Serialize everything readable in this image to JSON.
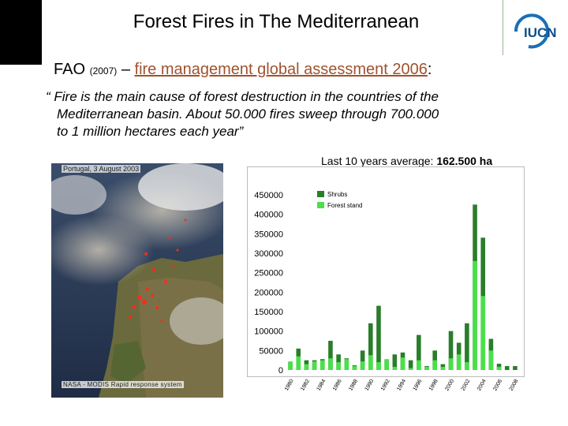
{
  "slide": {
    "title": "Forest Fires in The Mediterranean",
    "fao_source": "FAO",
    "fao_year": "(2007)",
    "fao_dash": "–",
    "fao_link": "fire management global assessment 2006",
    "fao_colon": ":",
    "quote_line1": "“ Fire is the main cause of forest destruction in the countries of the",
    "quote_line2": "Mediterranean basin. About 50.000 fires sweep through 700.000",
    "quote_line3": "to 1 million hectares each year”",
    "logo_text": "IUCN",
    "photo_caption_top": "Portugal, 3 August 2003",
    "photo_caption_bottom": "NASA - MODIS Rapid response system",
    "avg_label": "Last 10 years average:",
    "avg_value": "162.500 ha"
  },
  "colors": {
    "shrubs": "#2a7d2a",
    "forest_stand": "#49e049",
    "link": "#a0522d"
  },
  "chart_data": {
    "type": "bar",
    "stacked": true,
    "categories": [
      "1980",
      "1981",
      "1982",
      "1983",
      "1984",
      "1985",
      "1986",
      "1987",
      "1988",
      "1989",
      "1990",
      "1991",
      "1992",
      "1993",
      "1994",
      "1995",
      "1996",
      "1997",
      "1998",
      "1999",
      "2000",
      "2001",
      "2002",
      "2003",
      "2004",
      "2005",
      "2006",
      "2007",
      "2008"
    ],
    "tick_labels": [
      "1980",
      "1982",
      "1984",
      "1986",
      "1988",
      "1990",
      "1992",
      "1994",
      "1996",
      "1998",
      "2000",
      "2002",
      "2004",
      "2006",
      "2008"
    ],
    "series": [
      {
        "name": "Forest stand",
        "values": [
          22000,
          35000,
          15000,
          22000,
          25000,
          30000,
          20000,
          28000,
          10000,
          22000,
          38000,
          20000,
          28000,
          8000,
          32000,
          5000,
          25000,
          8000,
          25000,
          8000,
          30000,
          40000,
          20000,
          280000,
          190000,
          50000,
          8000,
          0,
          0
        ]
      },
      {
        "name": "Shrubs",
        "values": [
          20000,
          55000,
          25000,
          25000,
          28000,
          75000,
          40000,
          30000,
          12000,
          50000,
          120000,
          165000,
          25000,
          40000,
          45000,
          25000,
          90000,
          10000,
          50000,
          15000,
          100000,
          70000,
          120000,
          425000,
          340000,
          80000,
          16000,
          10000,
          10000
        ]
      }
    ],
    "series_totals_note": "",
    "ylim": [
      0,
      450000
    ],
    "yticks": [
      0,
      50000,
      100000,
      150000,
      200000,
      250000,
      300000,
      350000,
      400000,
      450000
    ],
    "ytick_labels": [
      "0",
      "50000",
      "100000",
      "150000",
      "200000",
      "250000",
      "300000",
      "350000",
      "400000",
      "450000"
    ],
    "legend": [
      "Shrubs",
      "Forest stand"
    ],
    "legend_position": "top-left",
    "grid": false
  }
}
